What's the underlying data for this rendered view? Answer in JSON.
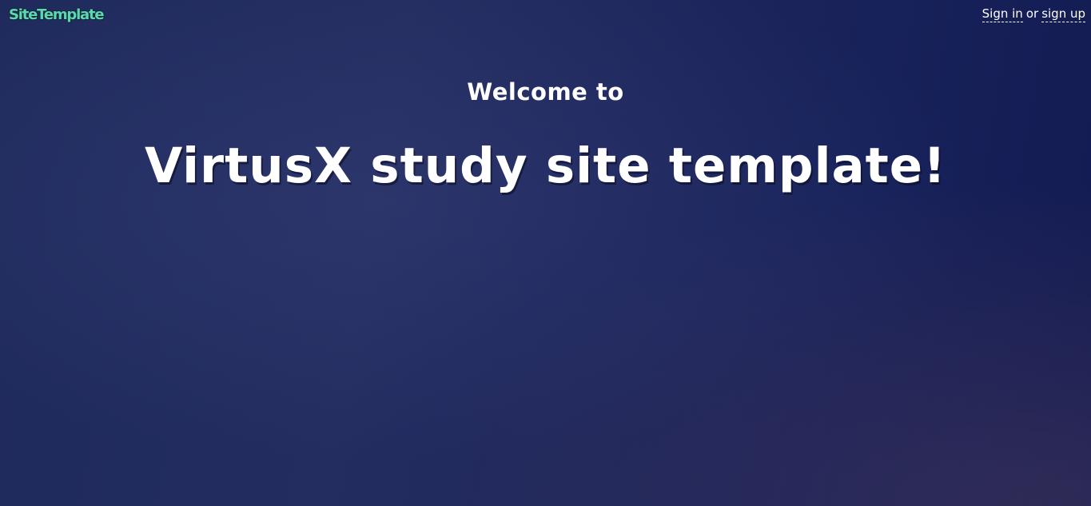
{
  "header": {
    "brand": "SiteTemplate",
    "auth": {
      "sign_in_label": "Sign in",
      "separator": "or",
      "sign_up_label": "sign up"
    }
  },
  "hero": {
    "welcome": "Welcome to",
    "headline": "VirtusX study site template!"
  },
  "colors": {
    "brand": "#5fd6b0",
    "background": "#1f2a5c",
    "text": "#ffffff"
  }
}
